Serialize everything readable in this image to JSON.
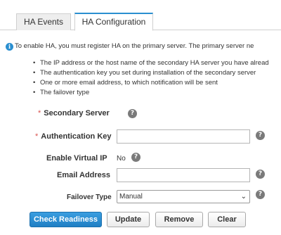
{
  "tabs": [
    {
      "label": "HA Events"
    },
    {
      "label": "HA Configuration"
    }
  ],
  "notice": "To enable HA, you must register HA on the primary server. The primary server ne",
  "bullets": [
    "The IP address or the host name of the secondary HA server you have alread",
    "The authentication key you set during installation of the secondary server",
    "One or more email address, to which notification will be sent",
    "The failover type"
  ],
  "form": {
    "required_mark": "*",
    "secondary_server_label": "Secondary Server",
    "auth_key_label": "Authentication Key",
    "auth_key_value": "",
    "virtual_ip_label": "Enable Virtual IP",
    "virtual_ip_value": "No",
    "email_label": "Email Address",
    "email_value": "",
    "failover_label": "Failover Type",
    "failover_value": "Manual",
    "help_glyph": "?"
  },
  "buttons": {
    "check_readiness": "Check Readiness",
    "update": "Update",
    "remove": "Remove",
    "clear": "Clear"
  },
  "colors": {
    "accent": "#2a8fd0",
    "required": "#d9534f"
  },
  "icons": {
    "info": "info-icon",
    "help": "help-icon",
    "dropdown": "chevron-down-icon"
  }
}
